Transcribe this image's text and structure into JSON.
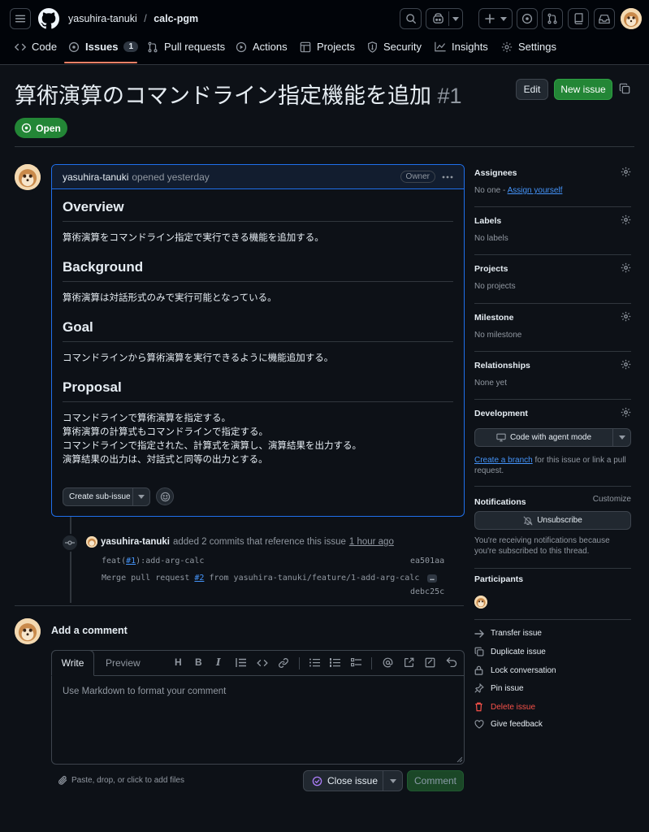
{
  "header": {
    "owner": "yasuhira-tanuki",
    "separator": "/",
    "repo": "calc-pgm"
  },
  "tabs": [
    {
      "label": "Code"
    },
    {
      "label": "Issues",
      "count": "1"
    },
    {
      "label": "Pull requests"
    },
    {
      "label": "Actions"
    },
    {
      "label": "Projects"
    },
    {
      "label": "Security"
    },
    {
      "label": "Insights"
    },
    {
      "label": "Settings"
    }
  ],
  "issue": {
    "title": "算術演算のコマンドライン指定機能を追加",
    "number": "#1",
    "state": "Open",
    "edit_label": "Edit",
    "new_issue_label": "New issue"
  },
  "comment": {
    "author": "yasuhira-tanuki",
    "meta": "opened yesterday",
    "owner_badge": "Owner",
    "sections": [
      {
        "heading": "Overview",
        "lines": [
          "算術演算をコマンドライン指定で実行できる機能を追加する。"
        ]
      },
      {
        "heading": "Background",
        "lines": [
          "算術演算は対話形式のみで実行可能となっている。"
        ]
      },
      {
        "heading": "Goal",
        "lines": [
          "コマンドラインから算術演算を実行できるように機能追加する。"
        ]
      },
      {
        "heading": "Proposal",
        "lines": [
          "コマンドラインで算術演算を指定する。",
          "算術演算の計算式もコマンドラインで指定する。",
          "コマンドラインで指定された、計算式を演算し、演算結果を出力する。",
          "演算結果の出力は、対話式と同等の出力とする。"
        ]
      }
    ],
    "sub_issue_label": "Create sub-issue"
  },
  "timeline": {
    "author": "yasuhira-tanuki",
    "text": "added 2 commits that reference this issue",
    "time": "1 hour ago",
    "commits": [
      {
        "pre": "feat(",
        "ref": "#1",
        "post": "):add-arg-calc",
        "sha": "ea501aa"
      },
      {
        "pre": "Merge pull request ",
        "ref": "#2",
        "post": " from yasuhira-tanuki/feature/1-add-arg-calc",
        "more": "…",
        "sha": "debc25c"
      }
    ]
  },
  "new_comment": {
    "heading": "Add a comment",
    "write_tab": "Write",
    "preview_tab": "Preview",
    "placeholder": "Use Markdown to format your comment",
    "attach_text": "Paste, drop, or click to add files",
    "close_label": "Close issue",
    "submit_label": "Comment"
  },
  "sidebar": {
    "assignees": {
      "heading": "Assignees",
      "value": "No one - ",
      "link": "Assign yourself"
    },
    "labels": {
      "heading": "Labels",
      "value": "No labels"
    },
    "projects": {
      "heading": "Projects",
      "value": "No projects"
    },
    "milestone": {
      "heading": "Milestone",
      "value": "No milestone"
    },
    "relationships": {
      "heading": "Relationships",
      "value": "None yet"
    },
    "development": {
      "heading": "Development",
      "agent_button": "Code with agent mode",
      "link": "Create a branch",
      "text": " for this issue or link a pull request."
    },
    "notifications": {
      "heading": "Notifications",
      "customize": "Customize",
      "unsubscribe": "Unsubscribe",
      "note": "You're receiving notifications because you're subscribed to this thread."
    },
    "participants": {
      "heading": "Participants"
    },
    "actions": [
      "Transfer issue",
      "Duplicate issue",
      "Lock conversation",
      "Pin issue",
      "Delete issue",
      "Give feedback"
    ]
  },
  "colors": {
    "accent": "#4493f8",
    "open_green": "#238636",
    "danger": "#f85149",
    "background": "#0d1117"
  }
}
